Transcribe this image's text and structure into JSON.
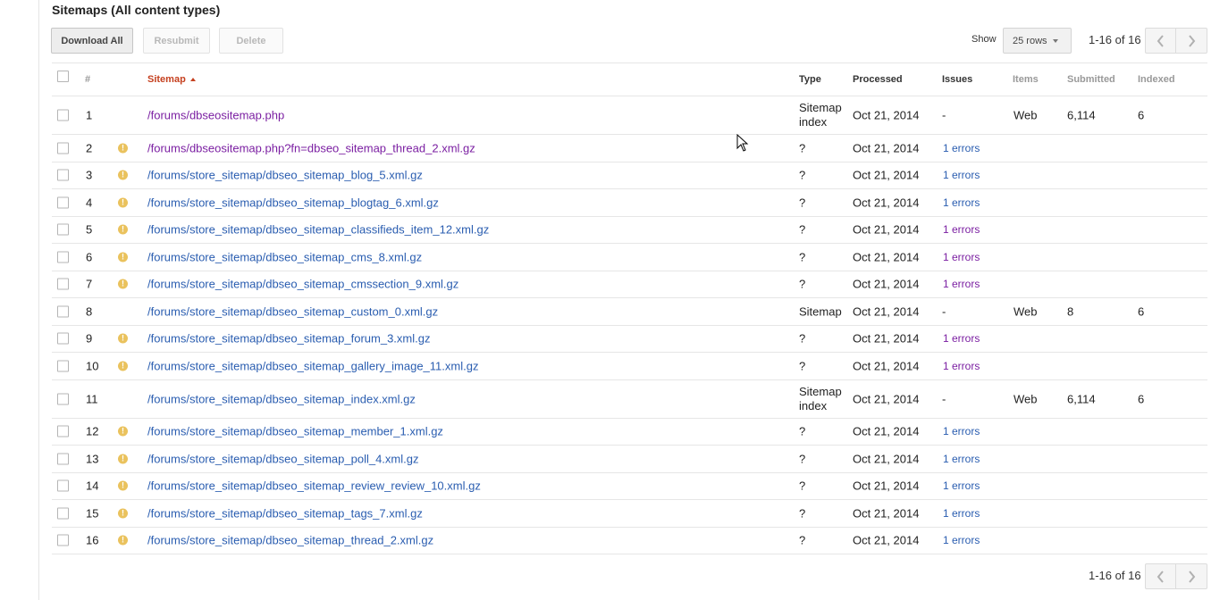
{
  "section_title": "Sitemaps (All content types)",
  "toolbar": {
    "download_all": "Download All",
    "resubmit": "Resubmit",
    "delete": "Delete",
    "show_label": "Show",
    "rows_value": "25 rows"
  },
  "pagination": {
    "range_top": "1-16 of 16",
    "range_bottom": "1-16 of 16"
  },
  "columns": {
    "num": "#",
    "sitemap": "Sitemap",
    "type": "Type",
    "processed": "Processed",
    "issues": "Issues",
    "items": "Items",
    "submitted": "Submitted",
    "indexed": "Indexed"
  },
  "rows": [
    {
      "num": "1",
      "warn": false,
      "path": "/forums/dbseositemap.php",
      "visited": true,
      "type": "Sitemap index",
      "processed": "Oct 21, 2014",
      "issues": "-",
      "issues_link": false,
      "items": "Web",
      "submitted": "6,114",
      "indexed": "6"
    },
    {
      "num": "2",
      "warn": true,
      "path": "/forums/dbseositemap.php?fn=dbseo_sitemap_thread_2.xml.gz",
      "visited": true,
      "type": "?",
      "processed": "Oct 21, 2014",
      "issues": "1 errors",
      "issues_link": true,
      "issues_visited": false,
      "items": "",
      "submitted": "",
      "indexed": ""
    },
    {
      "num": "3",
      "warn": true,
      "path": "/forums/store_sitemap/dbseo_sitemap_blog_5.xml.gz",
      "visited": false,
      "type": "?",
      "processed": "Oct 21, 2014",
      "issues": "1 errors",
      "issues_link": true,
      "issues_visited": false,
      "items": "",
      "submitted": "",
      "indexed": ""
    },
    {
      "num": "4",
      "warn": true,
      "path": "/forums/store_sitemap/dbseo_sitemap_blogtag_6.xml.gz",
      "visited": false,
      "type": "?",
      "processed": "Oct 21, 2014",
      "issues": "1 errors",
      "issues_link": true,
      "issues_visited": false,
      "items": "",
      "submitted": "",
      "indexed": ""
    },
    {
      "num": "5",
      "warn": true,
      "path": "/forums/store_sitemap/dbseo_sitemap_classifieds_item_12.xml.gz",
      "visited": false,
      "type": "?",
      "processed": "Oct 21, 2014",
      "issues": "1 errors",
      "issues_link": true,
      "issues_visited": true,
      "items": "",
      "submitted": "",
      "indexed": ""
    },
    {
      "num": "6",
      "warn": true,
      "path": "/forums/store_sitemap/dbseo_sitemap_cms_8.xml.gz",
      "visited": false,
      "type": "?",
      "processed": "Oct 21, 2014",
      "issues": "1 errors",
      "issues_link": true,
      "issues_visited": true,
      "items": "",
      "submitted": "",
      "indexed": ""
    },
    {
      "num": "7",
      "warn": true,
      "path": "/forums/store_sitemap/dbseo_sitemap_cmssection_9.xml.gz",
      "visited": false,
      "type": "?",
      "processed": "Oct 21, 2014",
      "issues": "1 errors",
      "issues_link": true,
      "issues_visited": true,
      "items": "",
      "submitted": "",
      "indexed": ""
    },
    {
      "num": "8",
      "warn": false,
      "path": "/forums/store_sitemap/dbseo_sitemap_custom_0.xml.gz",
      "visited": false,
      "type": "Sitemap",
      "processed": "Oct 21, 2014",
      "issues": "-",
      "issues_link": false,
      "items": "Web",
      "submitted": "8",
      "indexed": "6"
    },
    {
      "num": "9",
      "warn": true,
      "path": "/forums/store_sitemap/dbseo_sitemap_forum_3.xml.gz",
      "visited": false,
      "type": "?",
      "processed": "Oct 21, 2014",
      "issues": "1 errors",
      "issues_link": true,
      "issues_visited": true,
      "items": "",
      "submitted": "",
      "indexed": ""
    },
    {
      "num": "10",
      "warn": true,
      "path": "/forums/store_sitemap/dbseo_sitemap_gallery_image_11.xml.gz",
      "visited": false,
      "type": "?",
      "processed": "Oct 21, 2014",
      "issues": "1 errors",
      "issues_link": true,
      "issues_visited": true,
      "items": "",
      "submitted": "",
      "indexed": ""
    },
    {
      "num": "11",
      "warn": false,
      "path": "/forums/store_sitemap/dbseo_sitemap_index.xml.gz",
      "visited": false,
      "type": "Sitemap index",
      "processed": "Oct 21, 2014",
      "issues": "-",
      "issues_link": false,
      "items": "Web",
      "submitted": "6,114",
      "indexed": "6"
    },
    {
      "num": "12",
      "warn": true,
      "path": "/forums/store_sitemap/dbseo_sitemap_member_1.xml.gz",
      "visited": false,
      "type": "?",
      "processed": "Oct 21, 2014",
      "issues": "1 errors",
      "issues_link": true,
      "issues_visited": false,
      "items": "",
      "submitted": "",
      "indexed": ""
    },
    {
      "num": "13",
      "warn": true,
      "path": "/forums/store_sitemap/dbseo_sitemap_poll_4.xml.gz",
      "visited": false,
      "type": "?",
      "processed": "Oct 21, 2014",
      "issues": "1 errors",
      "issues_link": true,
      "issues_visited": false,
      "items": "",
      "submitted": "",
      "indexed": ""
    },
    {
      "num": "14",
      "warn": true,
      "path": "/forums/store_sitemap/dbseo_sitemap_review_review_10.xml.gz",
      "visited": false,
      "type": "?",
      "processed": "Oct 21, 2014",
      "issues": "1 errors",
      "issues_link": true,
      "issues_visited": false,
      "items": "",
      "submitted": "",
      "indexed": ""
    },
    {
      "num": "15",
      "warn": true,
      "path": "/forums/store_sitemap/dbseo_sitemap_tags_7.xml.gz",
      "visited": false,
      "type": "?",
      "processed": "Oct 21, 2014",
      "issues": "1 errors",
      "issues_link": true,
      "issues_visited": false,
      "items": "",
      "submitted": "",
      "indexed": ""
    },
    {
      "num": "16",
      "warn": true,
      "path": "/forums/store_sitemap/dbseo_sitemap_thread_2.xml.gz",
      "visited": false,
      "type": "?",
      "processed": "Oct 21, 2014",
      "issues": "1 errors",
      "issues_link": true,
      "issues_visited": false,
      "items": "",
      "submitted": "",
      "indexed": ""
    }
  ],
  "icons": {
    "warning": "warning-icon",
    "prev": "chevron-left-icon",
    "next": "chevron-right-icon",
    "sort": "sort-ascending-icon",
    "cursor": "mouse-pointer-icon"
  },
  "colors": {
    "link": "#2a5db0",
    "visited_link": "#7b1fa2",
    "sort_header": "#c5401f",
    "warning": "#eac25d"
  }
}
